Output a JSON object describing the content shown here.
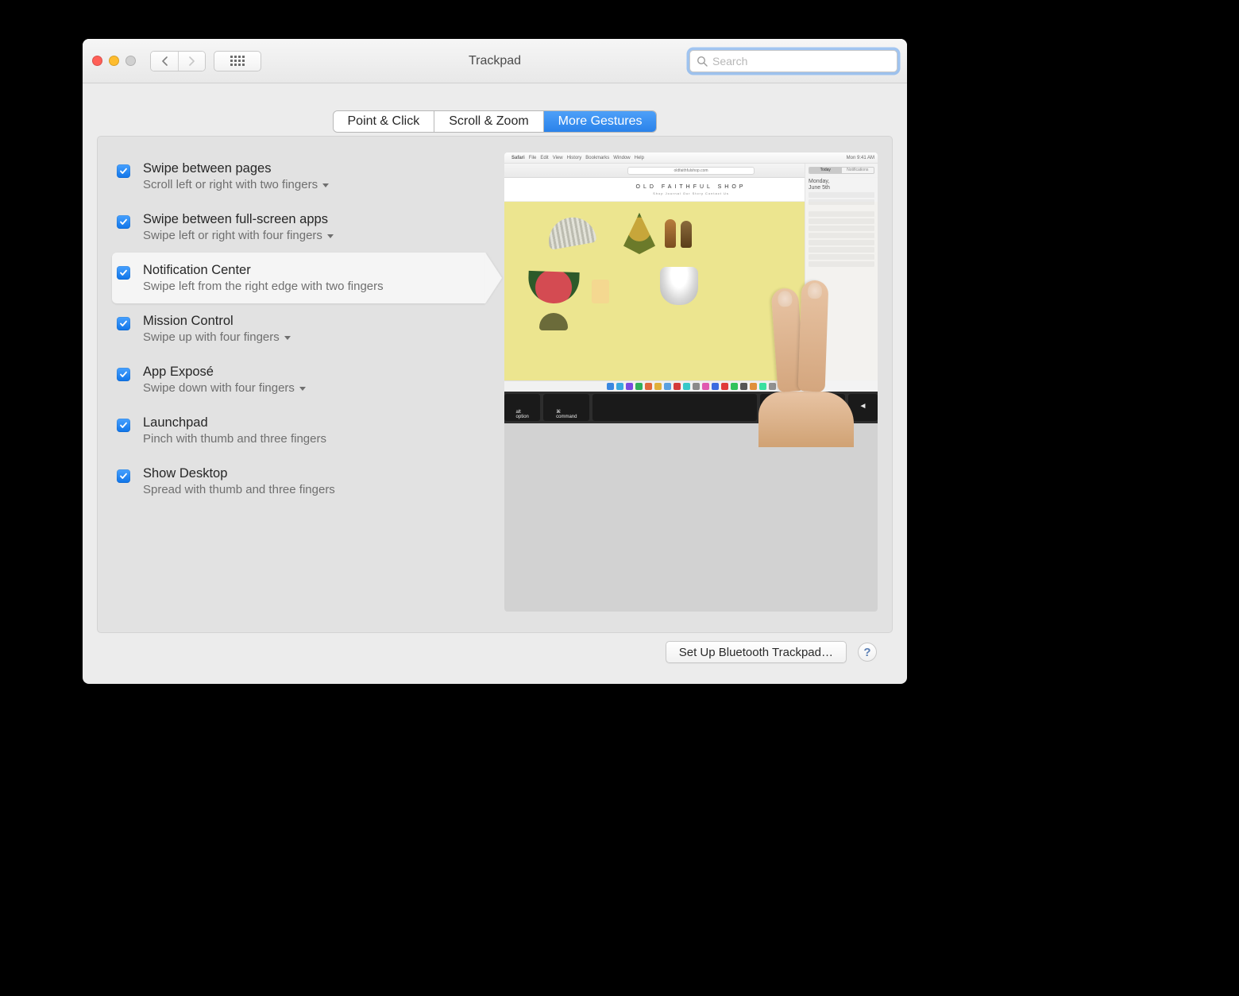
{
  "window": {
    "title": "Trackpad"
  },
  "search": {
    "placeholder": "Search",
    "value": ""
  },
  "tabs": [
    {
      "label": "Point & Click",
      "active": false
    },
    {
      "label": "Scroll & Zoom",
      "active": false
    },
    {
      "label": "More Gestures",
      "active": true
    }
  ],
  "gestures": [
    {
      "title": "Swipe between pages",
      "subtitle": "Scroll left or right with two fingers",
      "checked": true,
      "dropdown": true,
      "selected": false
    },
    {
      "title": "Swipe between full-screen apps",
      "subtitle": "Swipe left or right with four fingers",
      "checked": true,
      "dropdown": true,
      "selected": false
    },
    {
      "title": "Notification Center",
      "subtitle": "Swipe left from the right edge with two fingers",
      "checked": true,
      "dropdown": false,
      "selected": true
    },
    {
      "title": "Mission Control",
      "subtitle": "Swipe up with four fingers",
      "checked": true,
      "dropdown": true,
      "selected": false
    },
    {
      "title": "App Exposé",
      "subtitle": "Swipe down with four fingers",
      "checked": true,
      "dropdown": true,
      "selected": false
    },
    {
      "title": "Launchpad",
      "subtitle": "Pinch with thumb and three fingers",
      "checked": true,
      "dropdown": false,
      "selected": false
    },
    {
      "title": "Show Desktop",
      "subtitle": "Spread with thumb and three fingers",
      "checked": true,
      "dropdown": false,
      "selected": false
    }
  ],
  "footer": {
    "bluetooth_button": "Set Up Bluetooth Trackpad…",
    "help": "?"
  },
  "preview": {
    "menubar_app": "Safari",
    "menubar_items": [
      "File",
      "Edit",
      "View",
      "History",
      "Bookmarks",
      "Window",
      "Help"
    ],
    "clock": "Mon 9:41 AM",
    "address": "oldfaithfulshop.com",
    "site_title": "OLD FAITHFUL SHOP",
    "site_nav": "Shop    Journal    Our Story    Contact Us",
    "nc_today": "Today",
    "nc_notifications": "Notifications",
    "nc_date_line1": "Monday,",
    "nc_date_line2": "June 5th",
    "keys": {
      "alt": "alt",
      "option": "option",
      "command": "command",
      "cmd_sym": "⌘"
    }
  }
}
